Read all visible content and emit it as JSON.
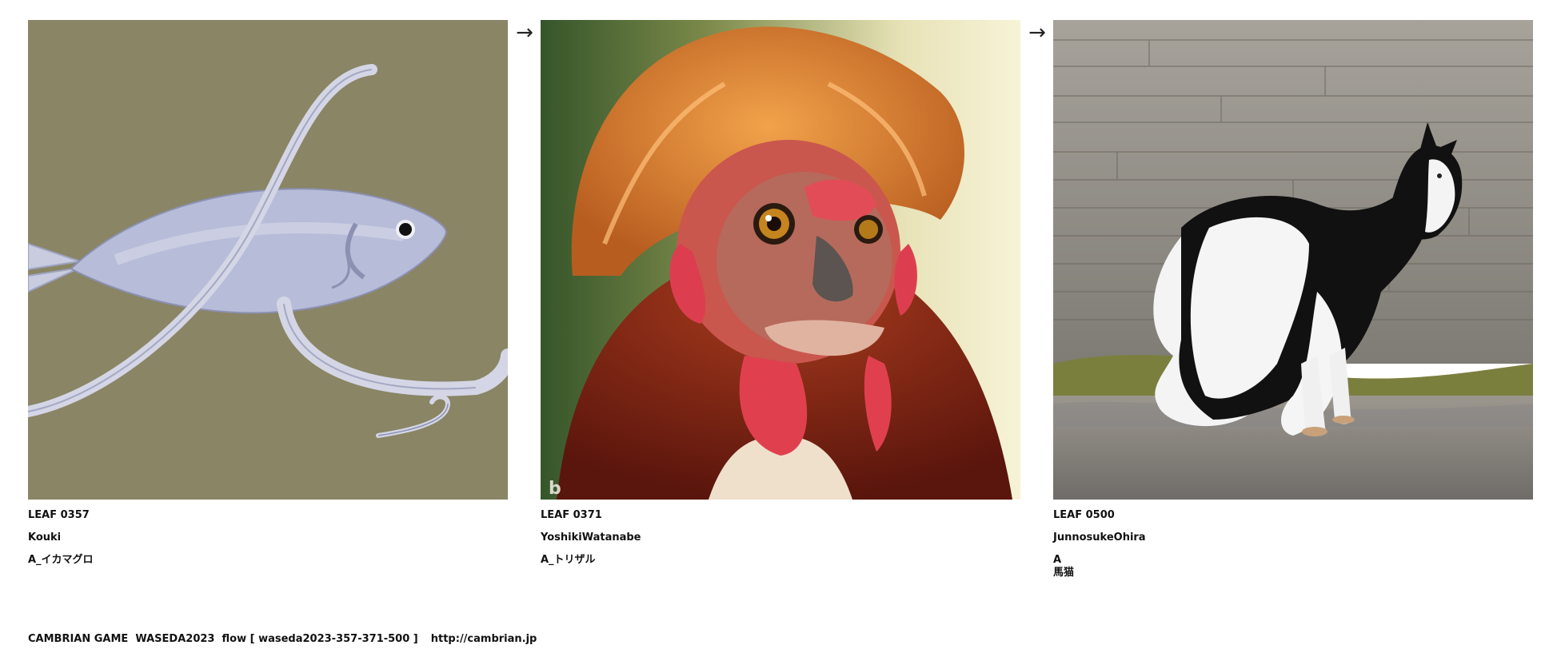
{
  "leaves": [
    {
      "id": "LEAF 0357",
      "author": "Kouki",
      "title_lines": [
        "A_イカマグロ"
      ],
      "image_subject": "squid-tuna illustration"
    },
    {
      "id": "LEAF 0371",
      "author": "YoshikiWatanabe",
      "title_lines": [
        "A_トリザル"
      ],
      "image_subject": "rooster-monkey photo"
    },
    {
      "id": "LEAF 0500",
      "author": "JunnosukeOhira",
      "title_lines": [
        "A",
        "馬猫"
      ],
      "image_subject": "horse-cat photo"
    }
  ],
  "arrows": [
    "→",
    "→"
  ],
  "footer": {
    "text": "CAMBRIAN GAME  WASEDA2023  flow [ waseda2023-357-371-500 ]",
    "link": "http://cambrian.jp"
  },
  "colors": {
    "fish_background": "#8c8868",
    "fish_body": "#b7bcd8",
    "rooster_bg_dark": "#3f5a2a",
    "rooster_bg_light": "#f3efc8",
    "rooster_feathers": "#d0782c",
    "rooster_face": "#d04a4a",
    "cat_wall": "#9a9690",
    "cat_ground": "#8a8784",
    "grass": "#7a8040"
  }
}
